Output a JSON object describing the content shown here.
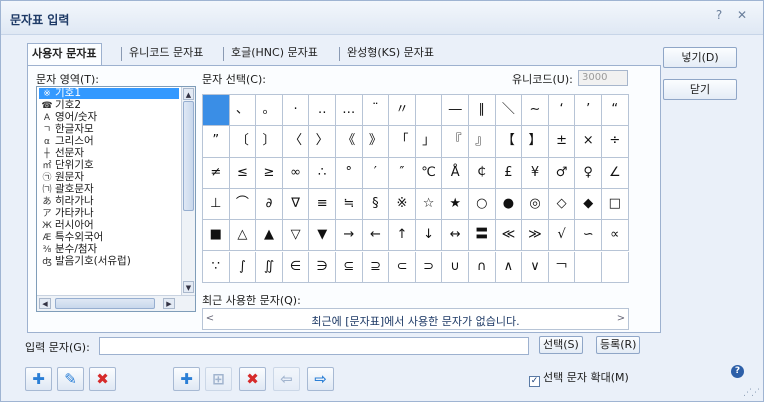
{
  "window": {
    "title": "문자표 입력",
    "help_glyph": "?",
    "close_glyph": "✕"
  },
  "tabs": [
    {
      "label": "사용자 문자표",
      "active": true
    },
    {
      "label": "유니코드 문자표",
      "active": false
    },
    {
      "label": "호글(HNC) 문자표",
      "active": false
    },
    {
      "label": "완성형(KS) 문자표",
      "active": false
    }
  ],
  "area": {
    "label": "문자 영역(T):",
    "items": [
      {
        "icon": "※",
        "label": "기호1",
        "selected": true
      },
      {
        "icon": "☎",
        "label": "기호2",
        "selected": false
      },
      {
        "icon": "A",
        "label": "영어/숫자",
        "selected": false
      },
      {
        "icon": "ㄱ",
        "label": "한글자모",
        "selected": false
      },
      {
        "icon": "α",
        "label": "그리스어",
        "selected": false
      },
      {
        "icon": "┼",
        "label": "선문자",
        "selected": false
      },
      {
        "icon": "㎡",
        "label": "단위기호",
        "selected": false
      },
      {
        "icon": "㉠",
        "label": "원문자",
        "selected": false
      },
      {
        "icon": "㈀",
        "label": "괄호문자",
        "selected": false
      },
      {
        "icon": "あ",
        "label": "히라가나",
        "selected": false
      },
      {
        "icon": "ア",
        "label": "가타카나",
        "selected": false
      },
      {
        "icon": "Ж",
        "label": "러시아어",
        "selected": false
      },
      {
        "icon": "Æ",
        "label": "특수외국어",
        "selected": false
      },
      {
        "icon": "⅜",
        "label": "분수/첨자",
        "selected": false
      },
      {
        "icon": "ʤ",
        "label": "발음기호(서유럽)",
        "selected": false
      }
    ],
    "scroll_up": "▲",
    "scroll_down": "▼",
    "scroll_left": "◀",
    "scroll_right": "▶"
  },
  "grid": {
    "label": "문자 선택(C):",
    "unicode_label": "유니코드(U):",
    "unicode_value": "3000",
    "rows": [
      [
        "",
        "、",
        "。",
        "·",
        "‥",
        "…",
        "¨",
        "〃",
        "­",
        "―",
        "∥",
        "＼",
        "∼",
        "‘",
        "’",
        "“"
      ],
      [
        "”",
        "〔",
        "〕",
        "〈",
        "〉",
        "《",
        "》",
        "「",
        "」",
        "『",
        "』",
        "【",
        "】",
        "±",
        "×",
        "÷"
      ],
      [
        "≠",
        "≤",
        "≥",
        "∞",
        "∴",
        "°",
        "′",
        "″",
        "℃",
        "Å",
        "￠",
        "£",
        "¥",
        "♂",
        "♀",
        "∠"
      ],
      [
        "⊥",
        "⌒",
        "∂",
        "∇",
        "≡",
        "≒",
        "§",
        "※",
        "☆",
        "★",
        "○",
        "●",
        "◎",
        "◇",
        "◆",
        "□"
      ],
      [
        "■",
        "△",
        "▲",
        "▽",
        "▼",
        "→",
        "←",
        "↑",
        "↓",
        "↔",
        "〓",
        "≪",
        "≫",
        "√",
        "∽",
        "∝"
      ],
      [
        "∵",
        "∫",
        "∬",
        "∈",
        "∋",
        "⊆",
        "⊇",
        "⊂",
        "⊃",
        "∪",
        "∩",
        "∧",
        "∨",
        "￢",
        "",
        ""
      ]
    ]
  },
  "recent": {
    "label": "최근 사용한 문자(Q):",
    "empty_message": "최근에 [문자표]에서 사용한 문자가 없습니다.",
    "prev_glyph": "<",
    "next_glyph": ">"
  },
  "buttons": {
    "insert": "넣기(D)",
    "close": "닫기",
    "select": "선택(S)",
    "register": "등록(R)"
  },
  "input": {
    "label": "입력 문자(G):",
    "value": ""
  },
  "toolbar": {
    "add_group": "✚",
    "edit_group": "✎",
    "delete_group": "✖",
    "add": "✚",
    "insert_disabled": "⊞",
    "delete": "✖",
    "left": "⇦",
    "right": "⇨"
  },
  "checkbox": {
    "label": "선택 문자 확대(M)",
    "checked": true,
    "check_glyph": "✓"
  },
  "colors": {
    "accent": "#3a8ee6",
    "title": "#1e3a66",
    "add": "#2b7fd6",
    "delete": "#d62b2b"
  }
}
